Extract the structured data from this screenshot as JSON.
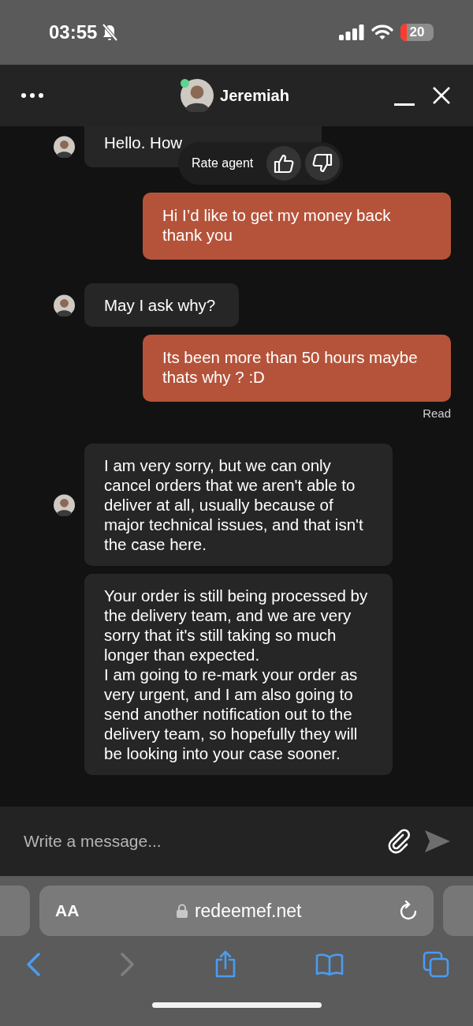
{
  "status_bar": {
    "time": "03:55",
    "silent": true,
    "battery": "20",
    "battery_low": true
  },
  "header": {
    "agent_name": "Jeremiah",
    "online": true
  },
  "messages": [
    {
      "kind": "agent",
      "avatar": true,
      "text": "Hello. How"
    },
    {
      "kind": "user",
      "text": "Hi I’d like to get my money back thank you"
    },
    {
      "kind": "agent",
      "avatar": true,
      "text": "May I ask why?"
    },
    {
      "kind": "user",
      "text": "Its been more than 50 hours maybe thats why ? :D",
      "receipt": "Read"
    },
    {
      "kind": "agent",
      "avatar": true,
      "text": "I am very sorry, but we can only cancel orders that we aren't able to deliver at all, usually because of major technical issues, and that isn't the case here."
    },
    {
      "kind": "agent",
      "avatar": false,
      "text": "Your order is still being processed by the delivery team, and we are very sorry that it's still taking so much longer than expected.\nI am going to re-mark your order as very urgent, and I am also going to send another notification out to the delivery team, so hopefully they will be looking into your case sooner."
    }
  ],
  "rate_popup": {
    "label": "Rate agent"
  },
  "composer": {
    "placeholder": "Write a message..."
  },
  "browser": {
    "text_size": "AA",
    "url": "redeemef.net",
    "back_disabled": false,
    "forward_disabled": true
  }
}
